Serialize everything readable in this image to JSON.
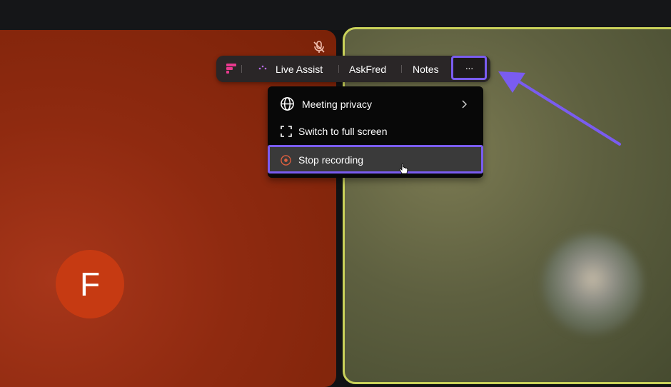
{
  "participant_left": {
    "initial": "F"
  },
  "toolbar": {
    "live_assist": "Live Assist",
    "askfred": "AskFred",
    "notes": "Notes",
    "more": "···"
  },
  "menu": {
    "items": [
      {
        "label": "Meeting privacy",
        "icon": "globe-icon"
      },
      {
        "label": "Switch to full screen",
        "icon": "fullscreen-icon"
      },
      {
        "label": "Stop recording",
        "icon": "stop-record-icon"
      }
    ]
  },
  "colors": {
    "accent_highlight": "#7a5cf0",
    "speaker_border": "#c9d15a",
    "avatar_bg": "#c63a12"
  }
}
